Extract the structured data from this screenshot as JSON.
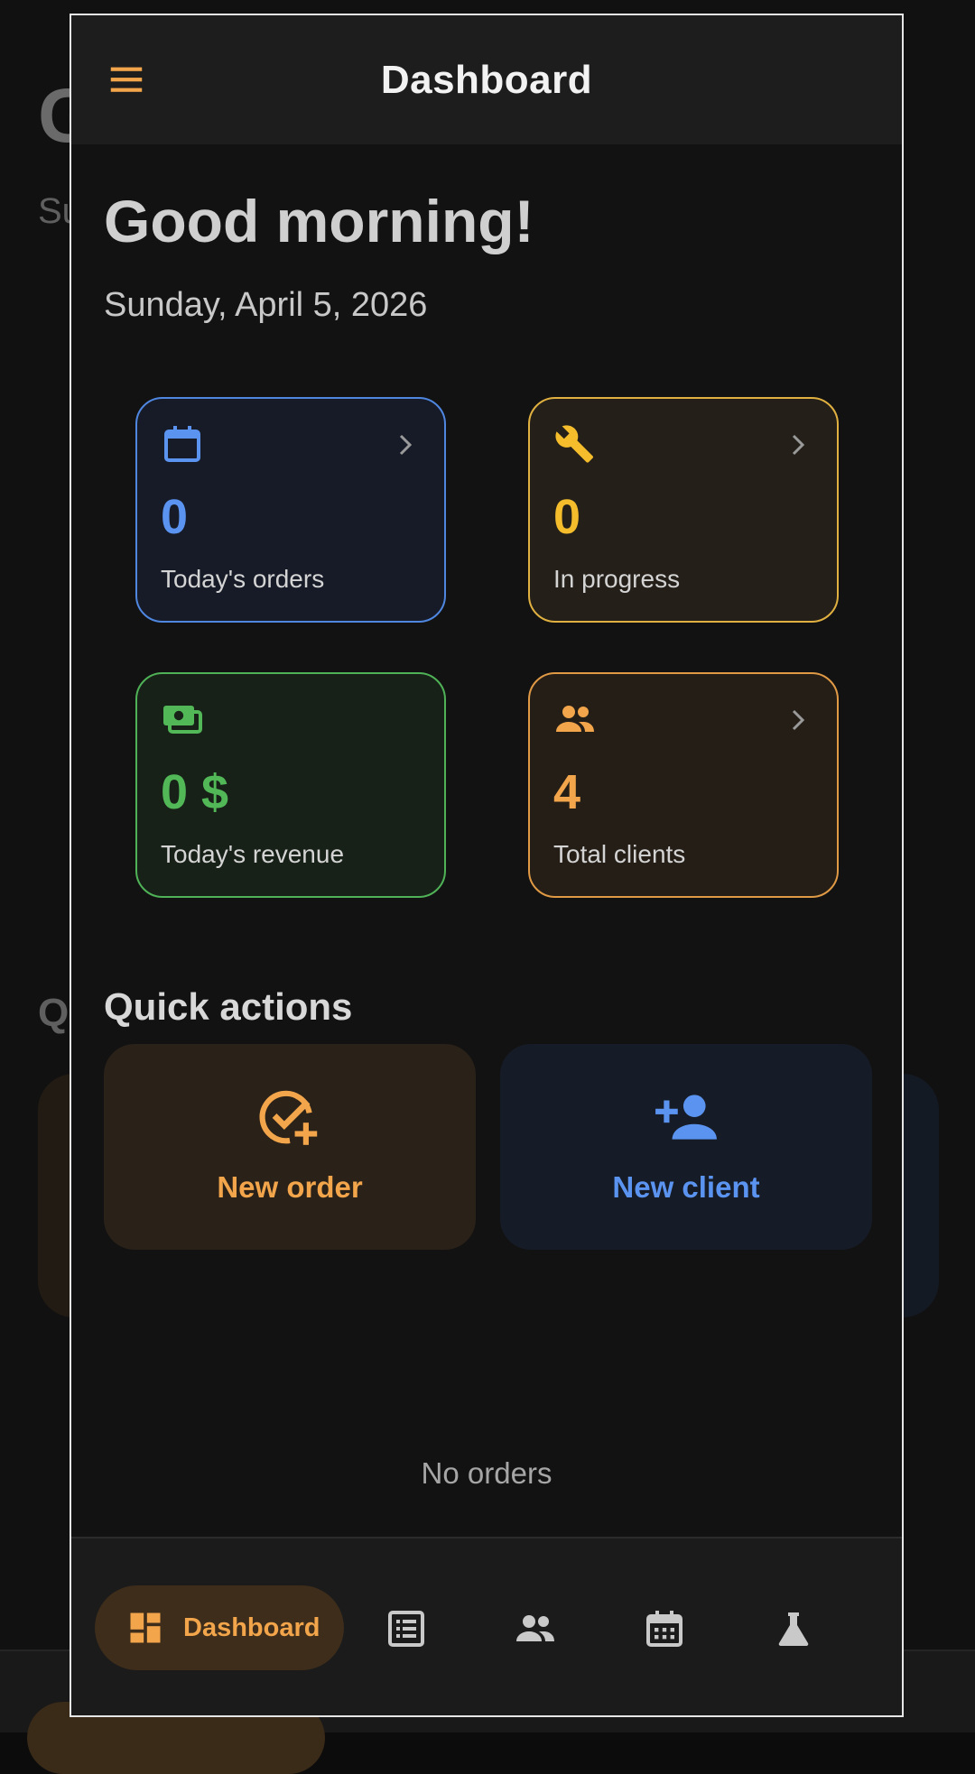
{
  "background": {
    "greeting_fragment": "G",
    "date_fragment": "Su",
    "section_fragment": "Q"
  },
  "appbar": {
    "title": "Dashboard",
    "menu_icon": "hamburger-menu-icon"
  },
  "greeting": "Good morning!",
  "date": "Sunday, April 5, 2026",
  "stats": [
    {
      "icon": "calendar-icon",
      "value": "0",
      "label": "Today's orders",
      "has_chevron": true,
      "accent": "#5b93f0"
    },
    {
      "icon": "wrench-icon",
      "value": "0",
      "label": "In progress",
      "has_chevron": true,
      "accent": "#f5bd2c"
    },
    {
      "icon": "money-icon",
      "value": "0 $",
      "label": "Today's revenue",
      "has_chevron": false,
      "accent": "#52b857"
    },
    {
      "icon": "people-icon",
      "value": "4",
      "label": "Total clients",
      "has_chevron": true,
      "accent": "#f2a54a"
    }
  ],
  "quick_actions": {
    "title": "Quick actions",
    "items": [
      {
        "icon": "check-circle-add-icon",
        "label": "New order",
        "accent": "#f2a54a"
      },
      {
        "icon": "person-add-icon",
        "label": "New client",
        "accent": "#5b93f0"
      }
    ]
  },
  "empty_state": "No orders",
  "bottom_nav": {
    "active": {
      "icon": "dashboard-icon",
      "label": "Dashboard"
    },
    "items": [
      {
        "icon": "list-icon"
      },
      {
        "icon": "people-icon"
      },
      {
        "icon": "calendar-grid-icon"
      },
      {
        "icon": "flask-icon"
      }
    ]
  }
}
